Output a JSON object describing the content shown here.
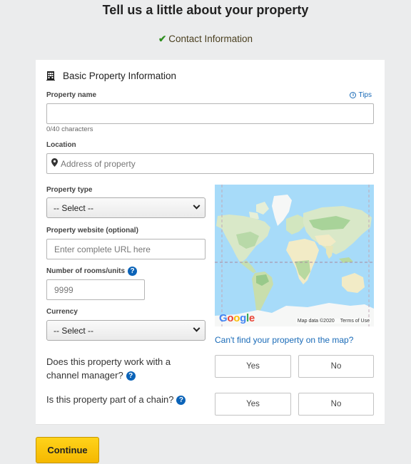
{
  "page": {
    "title": "Tell us a little about your property",
    "completed_step": "Contact Information"
  },
  "section": {
    "title": "Basic Property Information",
    "icon": "building-icon"
  },
  "fields": {
    "property_name": {
      "label": "Property name",
      "value": "",
      "counter": "0/40 characters",
      "tips_label": "Tips"
    },
    "location": {
      "label": "Location",
      "placeholder": "Address of property",
      "icon": "map-pin-icon"
    },
    "property_type": {
      "label": "Property type",
      "selected": "-- Select --"
    },
    "website": {
      "label": "Property website (optional)",
      "placeholder": "Enter complete URL here"
    },
    "rooms": {
      "label": "Number of rooms/units",
      "placeholder": "9999"
    },
    "currency": {
      "label": "Currency",
      "selected": "-- Select --"
    }
  },
  "map": {
    "logo": "Google",
    "attribution": "Map data ©2020",
    "terms": "Terms of Use",
    "cant_find_link": "Can't find your property on the map?"
  },
  "questions": [
    {
      "text": "Does this property work with a channel manager?",
      "yes": "Yes",
      "no": "No"
    },
    {
      "text": "Is this property part of a chain?",
      "yes": "Yes",
      "no": "No"
    }
  ],
  "actions": {
    "continue_label": "Continue"
  },
  "colors": {
    "accent": "#1a6bb8",
    "button": "#ffc700",
    "check": "#2f8f1f",
    "background": "#ebeced"
  }
}
